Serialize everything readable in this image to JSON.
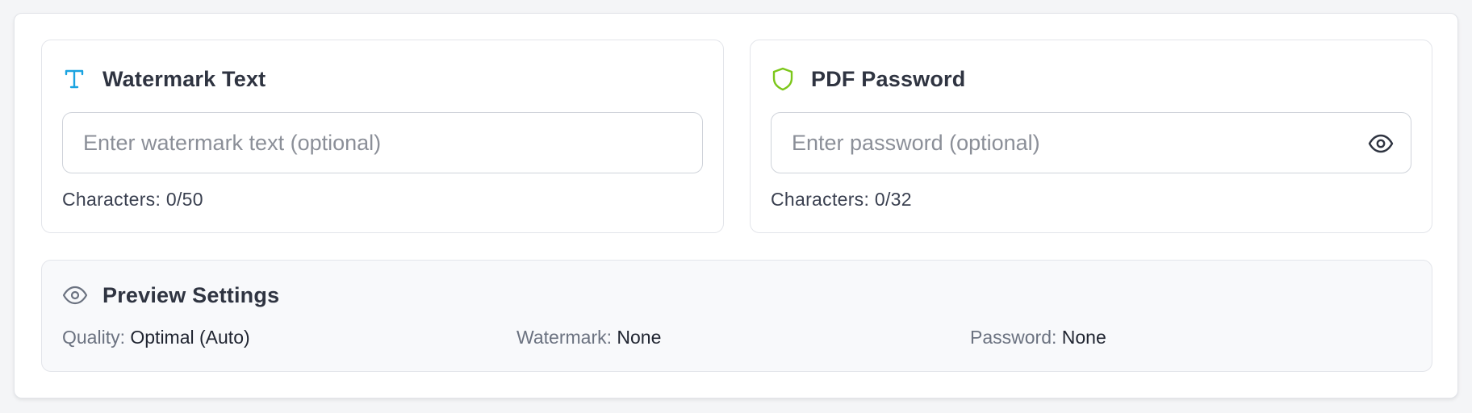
{
  "watermark": {
    "icon": "type-icon",
    "icon_color": "#1aa3e0",
    "title": "Watermark Text",
    "input_value": "",
    "placeholder": "Enter watermark text (optional)",
    "char_count": "Characters: 0/50"
  },
  "password": {
    "icon": "shield-icon",
    "icon_color": "#7cc71a",
    "title": "PDF Password",
    "input_value": "",
    "placeholder": "Enter password (optional)",
    "toggle_icon": "eye-icon",
    "char_count": "Characters: 0/32"
  },
  "preview": {
    "icon": "eye-icon",
    "title": "Preview Settings",
    "items": [
      {
        "label": "Quality:",
        "value": "Optimal (Auto)"
      },
      {
        "label": "Watermark:",
        "value": "None"
      },
      {
        "label": "Password:",
        "value": "None"
      }
    ]
  }
}
